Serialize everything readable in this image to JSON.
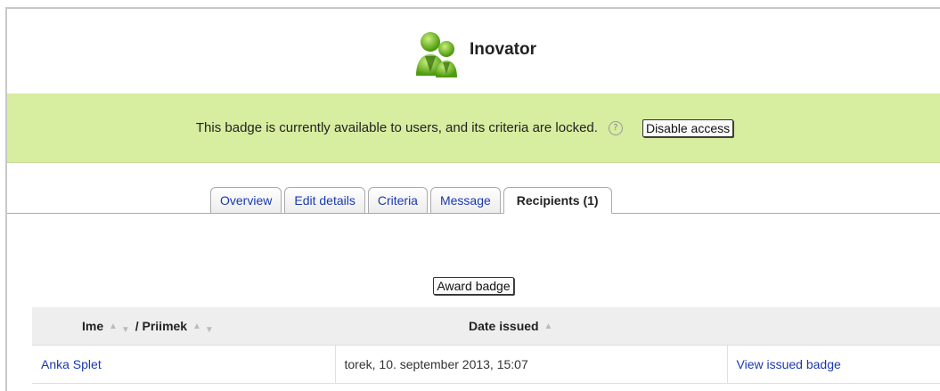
{
  "badge": {
    "name": "Inovator",
    "icon": "people-badge-icon"
  },
  "notice": {
    "text": "This badge is currently available to users, and its criteria are locked.",
    "help_glyph": "?",
    "disable_button": "Disable access"
  },
  "tabs": [
    {
      "label": "Overview"
    },
    {
      "label": "Edit details"
    },
    {
      "label": "Criteria"
    },
    {
      "label": "Message"
    },
    {
      "label": "Recipients (1)",
      "active": true
    }
  ],
  "award_button": "Award badge",
  "table": {
    "col_first": "Ime",
    "col_sep": "/",
    "col_last": "Priimek",
    "col_date": "Date issued",
    "rows": [
      {
        "name": "Anka Splet",
        "date": "torek, 10. september 2013, 15:07",
        "action": "View issued badge"
      }
    ]
  },
  "colors": {
    "notice_bg": "#d7eda0",
    "link": "#1a39b0"
  }
}
